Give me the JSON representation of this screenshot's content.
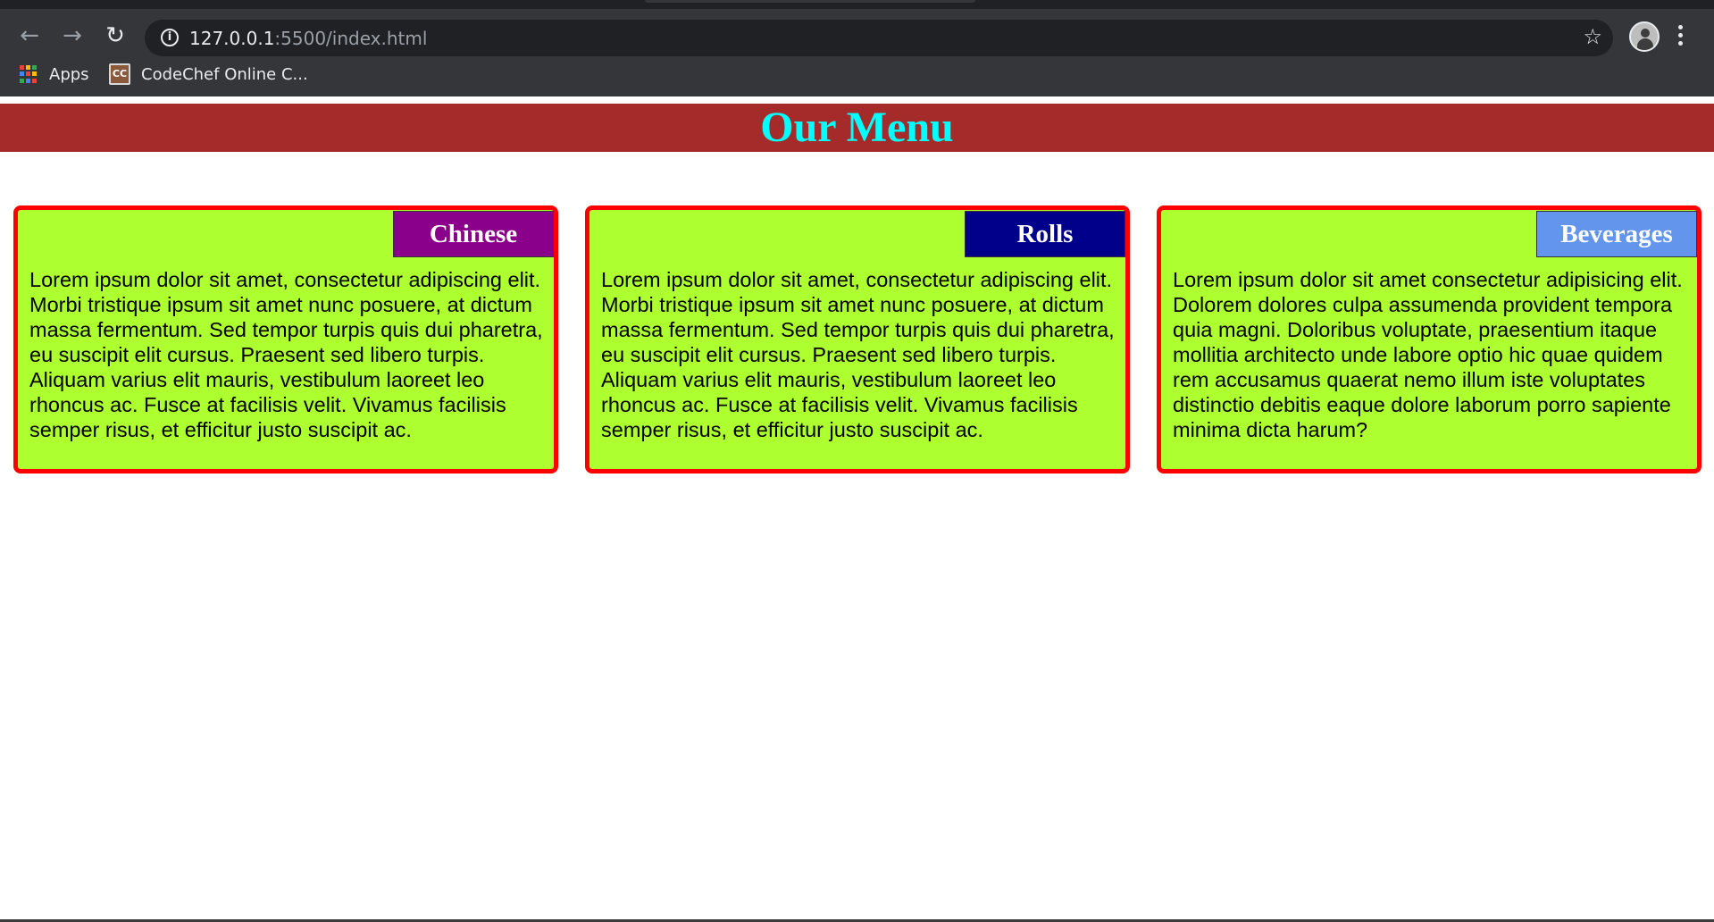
{
  "browser": {
    "url_host": "127.0.0.1",
    "url_rest": ":5500/index.html",
    "bookmarks": [
      {
        "label": "Apps",
        "icon": "apps-grid-icon"
      },
      {
        "label": "CodeChef Online C...",
        "icon": "codechef-icon",
        "icon_text": "CC"
      }
    ],
    "icons": {
      "back": "←",
      "forward": "→",
      "reload": "↻",
      "info": "i",
      "star": "☆"
    }
  },
  "page": {
    "title": "Our Menu",
    "colors": {
      "header_bg": "#a52a2a",
      "title": "#00ffff",
      "card_bg": "#adff2f",
      "card_border": "#ff0000"
    },
    "cards": [
      {
        "tag": "Chinese",
        "tag_color": "#8b008b",
        "text": "Lorem ipsum dolor sit amet, consectetur adipiscing elit. Morbi tristique ipsum sit amet nunc posuere, at dictum massa fermentum. Sed tempor turpis quis dui pharetra, eu suscipit elit cursus. Praesent sed libero turpis. Aliquam varius elit mauris, vestibulum laoreet leo rhoncus ac. Fusce at facilisis velit. Vivamus facilisis semper risus, et efficitur justo suscipit ac."
      },
      {
        "tag": "Rolls",
        "tag_color": "#00008b",
        "text": "Lorem ipsum dolor sit amet, consectetur adipiscing elit. Morbi tristique ipsum sit amet nunc posuere, at dictum massa fermentum. Sed tempor turpis quis dui pharetra, eu suscipit elit cursus. Praesent sed libero turpis. Aliquam varius elit mauris, vestibulum laoreet leo rhoncus ac. Fusce at facilisis velit. Vivamus facilisis semper risus, et efficitur justo suscipit ac."
      },
      {
        "tag": "Beverages",
        "tag_color": "#6495ed",
        "text": "Lorem ipsum dolor sit amet consectetur adipisicing elit. Dolorem dolores culpa assumenda provident tempora quia magni. Doloribus voluptate, praesentium itaque mollitia architecto unde labore optio hic quae quidem rem accusamus quaerat nemo illum iste voluptates distinctio debitis eaque dolore laborum porro sapiente minima dicta harum?"
      }
    ]
  }
}
